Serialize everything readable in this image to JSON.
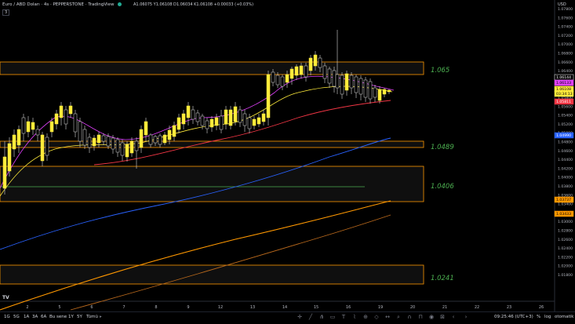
{
  "header": {
    "symbol_title": "Euro / ABD Doları · 4s · PEPPERSTONE · TradingView",
    "ohlc": "A1.06075  Y1.06108  D1.06034  K1.06108  +0.00033 (+0.03%)",
    "indicator_toggle": "3",
    "currency": "USD"
  },
  "zones": [
    {
      "label": "1.065",
      "color": "#4caf50"
    },
    {
      "label": "1.0489",
      "color": "#4caf50"
    },
    {
      "label": "1.0406",
      "color": "#4caf50"
    },
    {
      "label": "1.0241",
      "color": "#4caf50"
    }
  ],
  "price_axis": {
    "ticks": [
      "1.07800",
      "1.07600",
      "1.07400",
      "1.07200",
      "1.07000",
      "1.06800",
      "1.06600",
      "1.06400",
      "1.06200",
      "1.06000",
      "1.05800",
      "1.05600",
      "1.05400",
      "1.05200",
      "1.05000",
      "1.04800",
      "1.04600",
      "1.04400",
      "1.04200",
      "1.04000",
      "1.03800",
      "1.03600",
      "1.03400",
      "1.03200",
      "1.03000",
      "1.02800",
      "1.02600",
      "1.02400",
      "1.02200",
      "1.02000",
      "1.01800"
    ],
    "badges": [
      {
        "text": "1.06144",
        "color": "#ffffff",
        "bg": "#000000",
        "border": "#ffffff"
      },
      {
        "text": "1.06133",
        "color": "#000000",
        "bg": "#e040fb"
      },
      {
        "text": "1.06108",
        "color": "#000000",
        "bg": "#ffeb3b"
      },
      {
        "text": "03:34:13",
        "color": "#000000",
        "bg": "#ffeb3b"
      },
      {
        "text": "1.05811",
        "color": "#ffffff",
        "bg": "#f23645"
      },
      {
        "text": "1.04990",
        "color": "#ffffff",
        "bg": "#2962ff"
      },
      {
        "text": "1.03737",
        "color": "#000000",
        "bg": "#ff9800"
      },
      {
        "text": "1.03433",
        "color": "#000000",
        "bg": "#ff9800"
      }
    ]
  },
  "time_axis": {
    "ticks": [
      "2",
      "5",
      "6",
      "7",
      "8",
      "9",
      "12",
      "13",
      "14",
      "15",
      "16",
      "19",
      "20",
      "21",
      "22",
      "23",
      "26"
    ]
  },
  "bottom_bar": {
    "ranges": [
      "1G",
      "5G",
      "1A",
      "3A",
      "6A",
      "Bu sene",
      "1Y",
      "5Y",
      "Tümü"
    ],
    "clock": "09:25:46 (UTC+3)",
    "percent": "%",
    "log": "log",
    "auto": "otomatik"
  },
  "colors": {
    "candle": "#ffeb3b",
    "zone_border": "#ff9800",
    "sma_short": "#e040fb",
    "sma_mid": "#ffeb3b",
    "sma_red": "#f23645",
    "sma_blue": "#2962ff",
    "sma_orange": "#ff9800",
    "green_line": "#4caf50"
  }
}
